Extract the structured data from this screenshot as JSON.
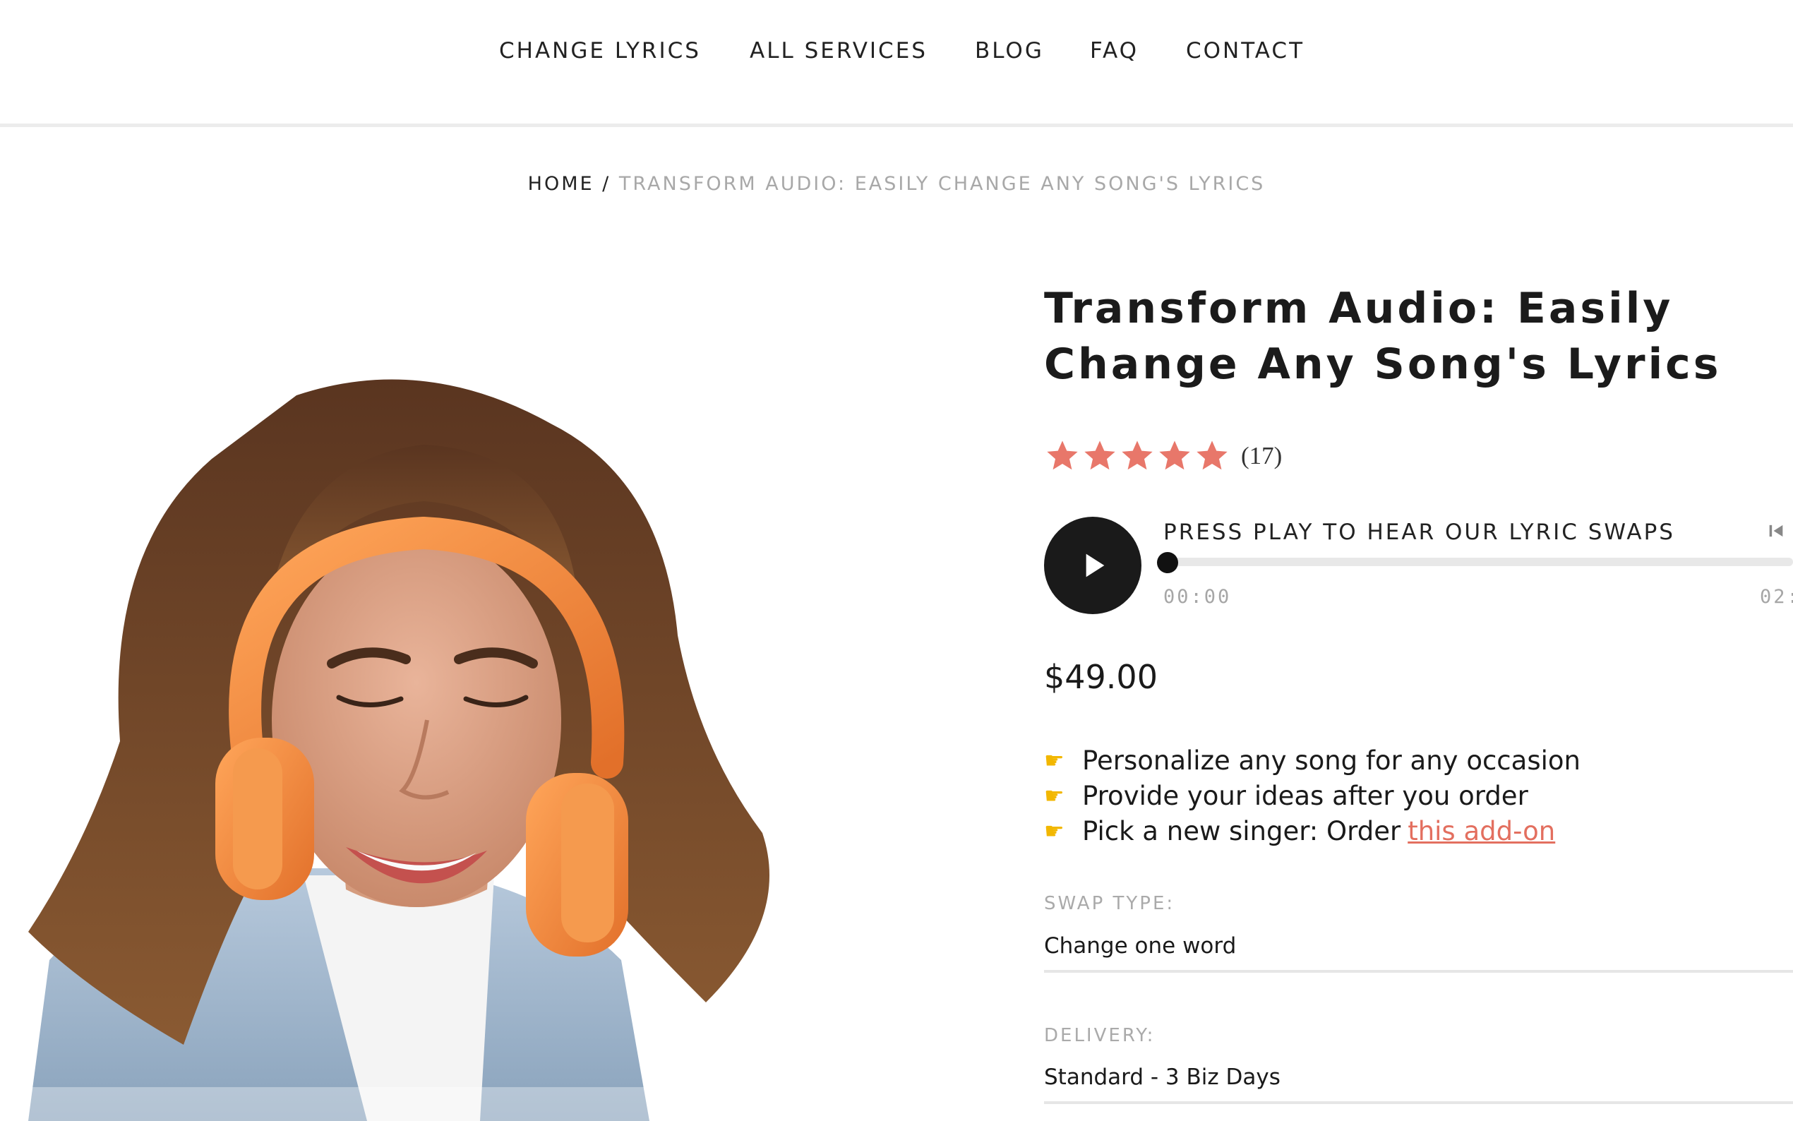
{
  "nav": {
    "items": [
      {
        "label": "CHANGE LYRICS"
      },
      {
        "label": "ALL SERVICES"
      },
      {
        "label": "BLOG"
      },
      {
        "label": "FAQ"
      },
      {
        "label": "CONTACT"
      }
    ]
  },
  "breadcrumb": {
    "home": "HOME",
    "separator": "/",
    "current": "TRANSFORM AUDIO: EASILY CHANGE ANY SONG'S LYRICS"
  },
  "product": {
    "title_line1": "Transform Audio: Easily",
    "title_line2": "Change Any Song's Lyrics",
    "rating": {
      "stars": 5,
      "max": 5,
      "count_text": "(17)",
      "star_color": "#e8776a"
    },
    "image_icon": "woman-with-orange-headphones-photo",
    "player": {
      "title": "PRESS PLAY TO HEAR OUR LYRIC SWAPS",
      "current_time": "00:00",
      "total_time": "02:",
      "progress": 0,
      "play_icon": "play-icon",
      "skip_icon": "skip-back-icon"
    },
    "price": "$49.00",
    "features": [
      {
        "icon": "pointing-hand-icon",
        "text": "Personalize any song for any occasion"
      },
      {
        "icon": "pointing-hand-icon",
        "text": "Provide your ideas after you order"
      },
      {
        "icon": "pointing-hand-icon",
        "text": "Pick a new singer: Order",
        "link": "this add-on"
      }
    ],
    "options": {
      "swap_type": {
        "label": "SWAP TYPE:",
        "value": "Change one word"
      },
      "delivery": {
        "label": "DELIVERY:",
        "value": "Standard - 3 Biz Days"
      }
    }
  },
  "colors": {
    "accent": "#e36f5f",
    "headphones": "#f2873a",
    "play_button": "#1a1a1a"
  }
}
